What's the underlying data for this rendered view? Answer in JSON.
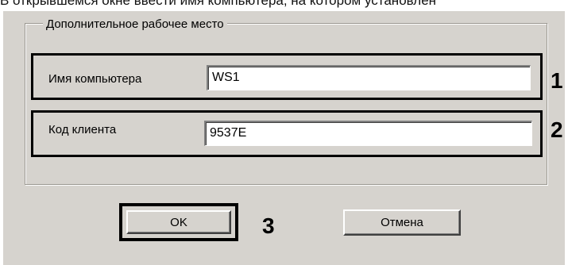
{
  "header_text": "В открывшемся окне ввести имя компьютера, на котором установлен",
  "dialog": {
    "group_title": "Дополнительное рабочее место",
    "fields": [
      {
        "label": "Имя компьютера",
        "value": "WS1",
        "callout": "1"
      },
      {
        "label": "Код клиента",
        "value": "9537E",
        "callout": "2"
      }
    ],
    "buttons": {
      "ok_label": "OK",
      "ok_callout": "3",
      "cancel_label": "Отмена"
    }
  }
}
